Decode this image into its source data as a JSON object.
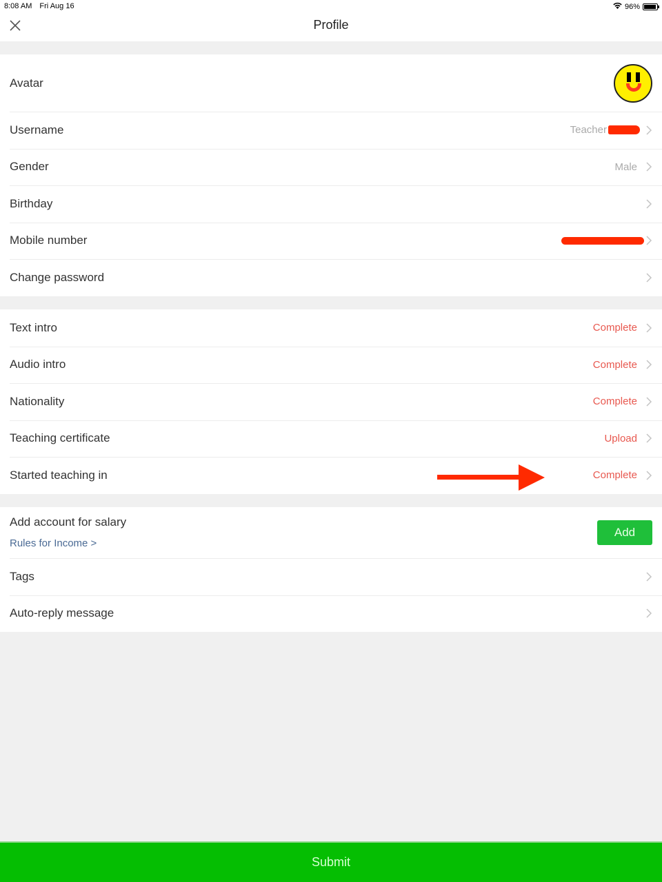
{
  "status_bar": {
    "time": "8:08 AM",
    "date": "Fri Aug 16",
    "battery": "96%",
    "battery_level": 0.96,
    "wifi_icon": "wifi-icon"
  },
  "nav": {
    "title": "Profile",
    "close_icon": "close-icon"
  },
  "colors": {
    "status_text": "#e8584f",
    "primary_green": "#05be02",
    "add_button": "#1fbf3a",
    "link": "#4a6a94",
    "redaction": "#ff2a00"
  },
  "basic_info": {
    "avatar_label": "Avatar",
    "rows": [
      {
        "label": "Username",
        "value": "Teacher",
        "redacted": true
      },
      {
        "label": "Gender",
        "value": "Male"
      },
      {
        "label": "Birthday",
        "value": ""
      },
      {
        "label": "Mobile number",
        "value": "",
        "redacted": true
      },
      {
        "label": "Change password",
        "value": ""
      }
    ]
  },
  "teaching_info": {
    "rows": [
      {
        "label": "Text intro",
        "value": "Complete"
      },
      {
        "label": "Audio intro",
        "value": "Complete"
      },
      {
        "label": "Nationality",
        "value": "Complete"
      },
      {
        "label": "Teaching certificate",
        "value": "Upload"
      },
      {
        "label": "Started teaching in",
        "value": "Complete"
      }
    ]
  },
  "salary": {
    "label": "Add account for salary",
    "rules_link": "Rules for Income >",
    "add_button": "Add"
  },
  "other": {
    "rows": [
      {
        "label": "Tags"
      },
      {
        "label": "Auto-reply message"
      }
    ]
  },
  "submit_label": "Submit"
}
